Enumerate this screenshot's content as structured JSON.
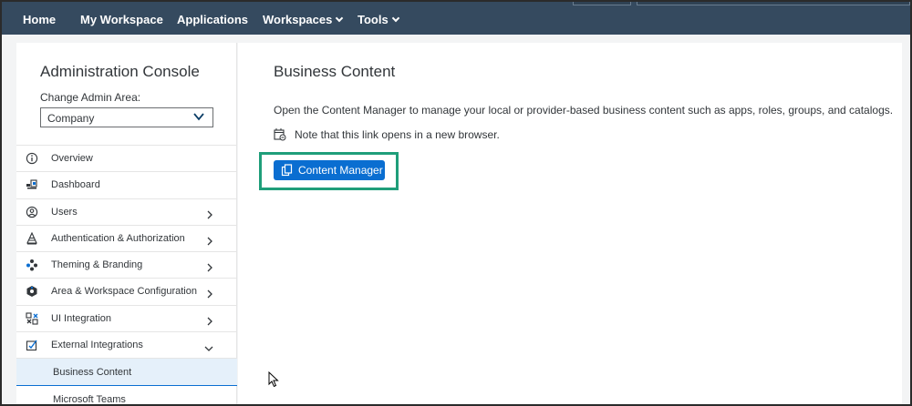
{
  "topnav": {
    "items": [
      {
        "label": "Home"
      },
      {
        "label": "My Workspace"
      },
      {
        "label": "Applications"
      },
      {
        "label": "Workspaces"
      },
      {
        "label": "Tools"
      }
    ]
  },
  "sidebar": {
    "title": "Administration Console",
    "admin_area_label": "Change Admin Area:",
    "admin_area_value": "Company",
    "items": [
      {
        "label": "Overview",
        "icon": "info-icon"
      },
      {
        "label": "Dashboard",
        "icon": "dashboard-icon"
      },
      {
        "label": "Users",
        "icon": "user-icon",
        "expand": "right"
      },
      {
        "label": "Authentication & Authorization",
        "icon": "authorization-icon",
        "expand": "right"
      },
      {
        "label": "Theming & Branding",
        "icon": "theming-icon",
        "expand": "right"
      },
      {
        "label": "Area & Workspace Configuration",
        "icon": "workspace-config-icon",
        "expand": "right"
      },
      {
        "label": "UI Integration",
        "icon": "ui-integration-icon",
        "expand": "right"
      },
      {
        "label": "External Integrations",
        "icon": "external-integrations-icon",
        "expand": "down"
      }
    ],
    "sub_items": [
      {
        "label": "Business Content",
        "active": true
      },
      {
        "label": "Microsoft Teams",
        "active": false
      }
    ]
  },
  "content": {
    "title": "Business Content",
    "description": "Open the Content Manager to manage your local or provider-based business content such as apps, roles, groups, and catalogs.",
    "note": "Note that this link opens in a new browser.",
    "button_label": "Content Manager"
  },
  "colors": {
    "shell": "#354a5f",
    "accent": "#0a6ed1",
    "highlight": "#1f9e7a"
  }
}
